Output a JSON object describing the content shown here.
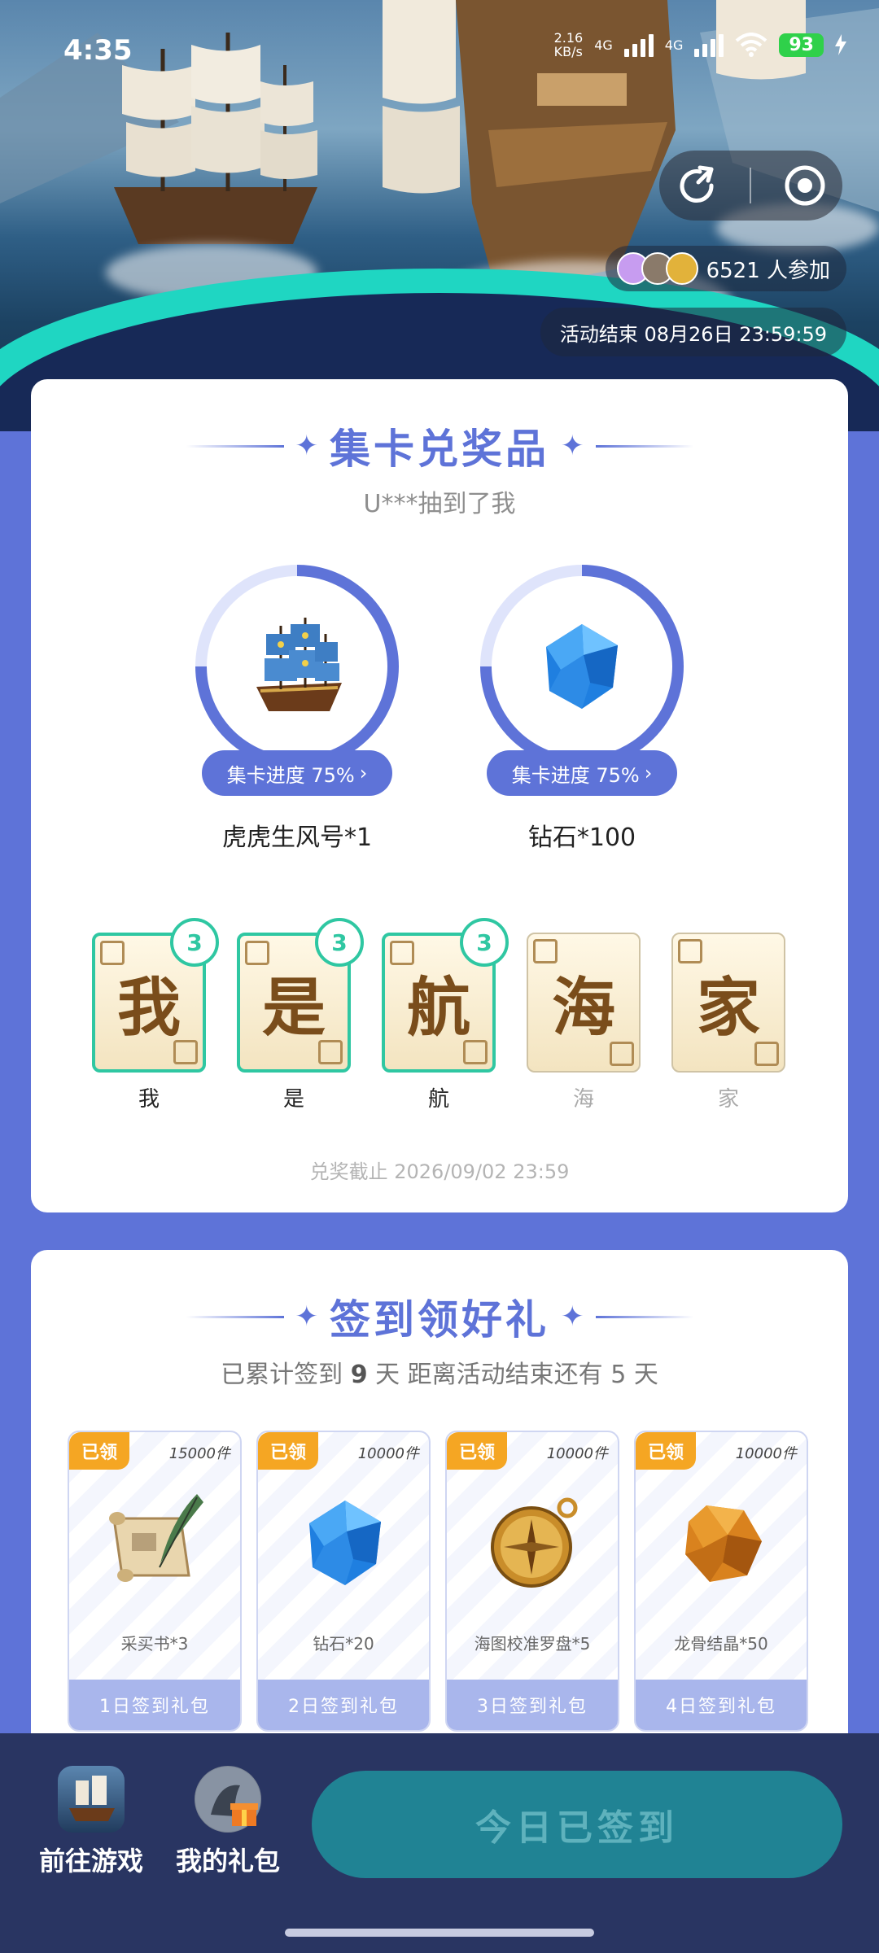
{
  "status_bar": {
    "time": "4:35",
    "net_speed_value": "2.16",
    "net_speed_unit": "KB/s",
    "signal1": "4G",
    "signal2": "4G",
    "battery": "93"
  },
  "hero": {
    "participants": "6521 人参加",
    "end_time": "活动结束 08月26日 23:59:59"
  },
  "collect": {
    "title": "集卡兑奖品",
    "subtitle": "U***抽到了我",
    "prizes": [
      {
        "name": "虎虎生风号*1",
        "progress_label": "集卡进度 75%",
        "progress": 0.75,
        "icon": "ship-icon"
      },
      {
        "name": "钻石*100",
        "progress_label": "集卡进度 75%",
        "progress": 0.75,
        "icon": "diamond-icon"
      }
    ],
    "cards": [
      {
        "char": "我",
        "label": "我",
        "count": "3",
        "collected": true
      },
      {
        "char": "是",
        "label": "是",
        "count": "3",
        "collected": true
      },
      {
        "char": "航",
        "label": "航",
        "count": "3",
        "collected": true
      },
      {
        "char": "海",
        "label": "海",
        "collected": false
      },
      {
        "char": "家",
        "label": "家",
        "collected": false
      }
    ],
    "deadline": "兑奖截止 2026/09/02 23:59"
  },
  "checkin": {
    "title": "签到领好礼",
    "summary_prefix": "已累计签到",
    "summary_days": "9",
    "summary_mid": "天  距离活动结束还有",
    "summary_remaining": "5",
    "summary_suffix": "天",
    "gifts": [
      {
        "tag": "已领",
        "qty": "15000件",
        "name": "采买书*3",
        "day_label": "1日签到礼包",
        "icon": "scroll-quill-icon"
      },
      {
        "tag": "已领",
        "qty": "10000件",
        "name": "钻石*20",
        "day_label": "2日签到礼包",
        "icon": "diamond-icon"
      },
      {
        "tag": "已领",
        "qty": "10000件",
        "name": "海图校准罗盘*5",
        "day_label": "3日签到礼包",
        "icon": "compass-icon"
      },
      {
        "tag": "已领",
        "qty": "10000件",
        "name": "龙骨结晶*50",
        "day_label": "4日签到礼包",
        "icon": "amber-crystal-icon"
      }
    ]
  },
  "bottom_bar": {
    "go_game_label": "前往游戏",
    "my_gifts_label": "我的礼包",
    "checkin_button": "今日已签到"
  },
  "colors": {
    "primary": "#5e73d8",
    "teal": "#2fc7a2",
    "tag_orange": "#f5a623",
    "bottom_bg": "#293562",
    "checkin_btn": "#208394"
  }
}
